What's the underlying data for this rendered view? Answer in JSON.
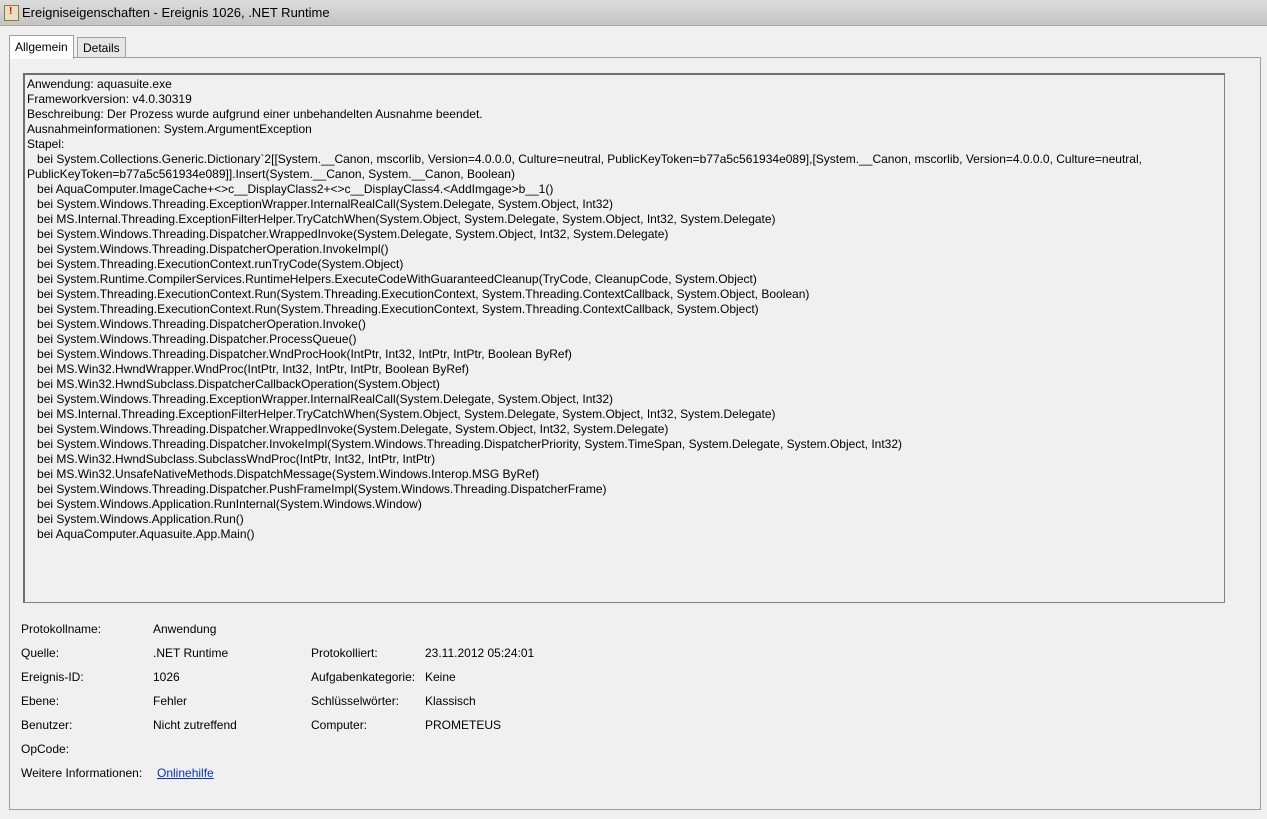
{
  "window": {
    "title": "Ereigniseigenschaften - Ereignis 1026, .NET Runtime"
  },
  "tabs": [
    {
      "label": "Allgemein",
      "active": true
    },
    {
      "label": "Details",
      "active": false
    }
  ],
  "description_lines": [
    "Anwendung: aquasuite.exe",
    "Frameworkversion: v4.0.30319",
    "Beschreibung: Der Prozess wurde aufgrund einer unbehandelten Ausnahme beendet.",
    "Ausnahmeinformationen: System.ArgumentException",
    "Stapel:",
    "   bei System.Collections.Generic.Dictionary`2[[System.__Canon, mscorlib, Version=4.0.0.0, Culture=neutral, PublicKeyToken=b77a5c561934e089],[System.__Canon, mscorlib, Version=4.0.0.0, Culture=neutral, PublicKeyToken=b77a5c561934e089]].Insert(System.__Canon, System.__Canon, Boolean)",
    "   bei AquaComputer.ImageCache+<>c__DisplayClass2+<>c__DisplayClass4.<AddImgage>b__1()",
    "   bei System.Windows.Threading.ExceptionWrapper.InternalRealCall(System.Delegate, System.Object, Int32)",
    "   bei MS.Internal.Threading.ExceptionFilterHelper.TryCatchWhen(System.Object, System.Delegate, System.Object, Int32, System.Delegate)",
    "   bei System.Windows.Threading.Dispatcher.WrappedInvoke(System.Delegate, System.Object, Int32, System.Delegate)",
    "   bei System.Windows.Threading.DispatcherOperation.InvokeImpl()",
    "   bei System.Threading.ExecutionContext.runTryCode(System.Object)",
    "   bei System.Runtime.CompilerServices.RuntimeHelpers.ExecuteCodeWithGuaranteedCleanup(TryCode, CleanupCode, System.Object)",
    "   bei System.Threading.ExecutionContext.Run(System.Threading.ExecutionContext, System.Threading.ContextCallback, System.Object, Boolean)",
    "   bei System.Threading.ExecutionContext.Run(System.Threading.ExecutionContext, System.Threading.ContextCallback, System.Object)",
    "   bei System.Windows.Threading.DispatcherOperation.Invoke()",
    "   bei System.Windows.Threading.Dispatcher.ProcessQueue()",
    "   bei System.Windows.Threading.Dispatcher.WndProcHook(IntPtr, Int32, IntPtr, IntPtr, Boolean ByRef)",
    "   bei MS.Win32.HwndWrapper.WndProc(IntPtr, Int32, IntPtr, IntPtr, Boolean ByRef)",
    "   bei MS.Win32.HwndSubclass.DispatcherCallbackOperation(System.Object)",
    "   bei System.Windows.Threading.ExceptionWrapper.InternalRealCall(System.Delegate, System.Object, Int32)",
    "   bei MS.Internal.Threading.ExceptionFilterHelper.TryCatchWhen(System.Object, System.Delegate, System.Object, Int32, System.Delegate)",
    "   bei System.Windows.Threading.Dispatcher.WrappedInvoke(System.Delegate, System.Object, Int32, System.Delegate)",
    "   bei System.Windows.Threading.Dispatcher.InvokeImpl(System.Windows.Threading.DispatcherPriority, System.TimeSpan, System.Delegate, System.Object, Int32)",
    "   bei MS.Win32.HwndSubclass.SubclassWndProc(IntPtr, Int32, IntPtr, IntPtr)",
    "   bei MS.Win32.UnsafeNativeMethods.DispatchMessage(System.Windows.Interop.MSG ByRef)",
    "   bei System.Windows.Threading.Dispatcher.PushFrameImpl(System.Windows.Threading.DispatcherFrame)",
    "   bei System.Windows.Application.RunInternal(System.Windows.Window)",
    "   bei System.Windows.Application.Run()",
    "   bei AquaComputer.Aquasuite.App.Main()"
  ],
  "fields": {
    "protokollname": {
      "label": "Protokollname:",
      "value": "Anwendung"
    },
    "quelle": {
      "label": "Quelle:",
      "value": ".NET Runtime"
    },
    "protokolliert": {
      "label": "Protokolliert:",
      "value": "23.11.2012 05:24:01"
    },
    "ereignis_id": {
      "label": "Ereignis-ID:",
      "value": "1026"
    },
    "aufgabenkategorie": {
      "label": "Aufgabenkategorie:",
      "value": "Keine"
    },
    "ebene": {
      "label": "Ebene:",
      "value": "Fehler"
    },
    "schluesselwoerter": {
      "label": "Schlüsselwörter:",
      "value": "Klassisch"
    },
    "benutzer": {
      "label": "Benutzer:",
      "value": "Nicht zutreffend"
    },
    "computer": {
      "label": "Computer:",
      "value": "PROMETEUS"
    },
    "opcode": {
      "label": "OpCode:",
      "value": ""
    },
    "weitere": {
      "label": "Weitere Informationen:",
      "link": "Onlinehilfe"
    }
  }
}
